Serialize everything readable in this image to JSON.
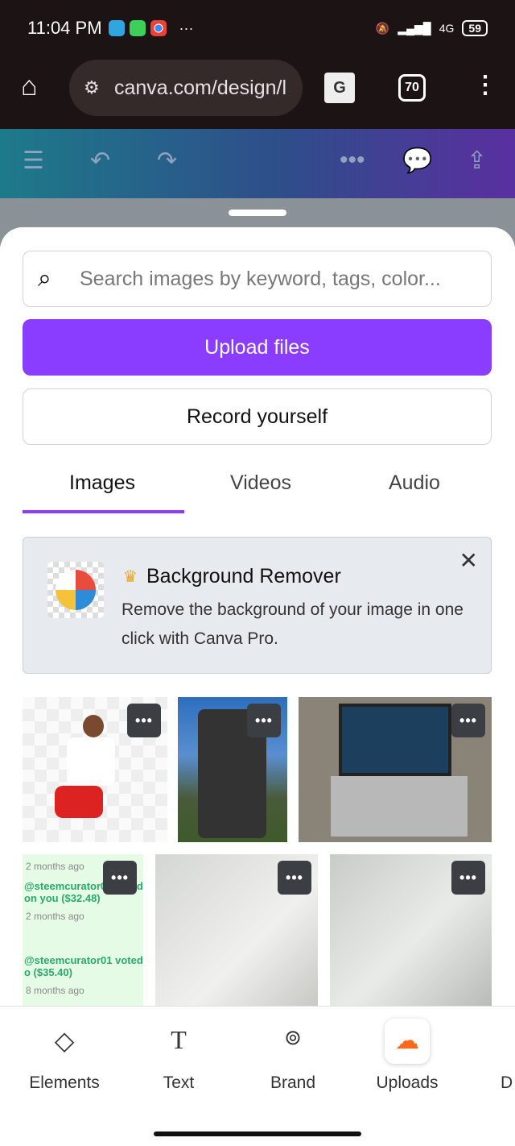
{
  "status": {
    "time": "11:04 PM",
    "network": "4G",
    "battery": "59"
  },
  "browser": {
    "url": "canva.com/design/l",
    "tab_count": "70"
  },
  "panel": {
    "search_placeholder": "Search images by keyword, tags, color...",
    "upload_label": "Upload files",
    "record_label": "Record yourself",
    "tabs": [
      "Images",
      "Videos",
      "Audio"
    ],
    "active_tab": "Images",
    "promo": {
      "title": "Background Remover",
      "body": "Remove the background of your image in one click with Canva Pro."
    },
    "thumb_text": {
      "t1": "2 months ago",
      "t2": "@steemcurator01 voted on you ($32.48)",
      "t3": "2 months ago",
      "t4": "@steemcurator01 voted o ($35.40)",
      "t5": "8 months ago"
    },
    "more_label": "•••"
  },
  "bottom_nav": [
    {
      "label": "Elements",
      "icon": "shapes-icon"
    },
    {
      "label": "Text",
      "icon": "text-icon"
    },
    {
      "label": "Brand",
      "icon": "brand-icon"
    },
    {
      "label": "Uploads",
      "icon": "cloud-upload-icon"
    },
    {
      "label": "D",
      "icon": "draw-icon"
    }
  ],
  "colors": {
    "accent": "#8b3dff",
    "upload_icon": "#ff6a1a"
  }
}
